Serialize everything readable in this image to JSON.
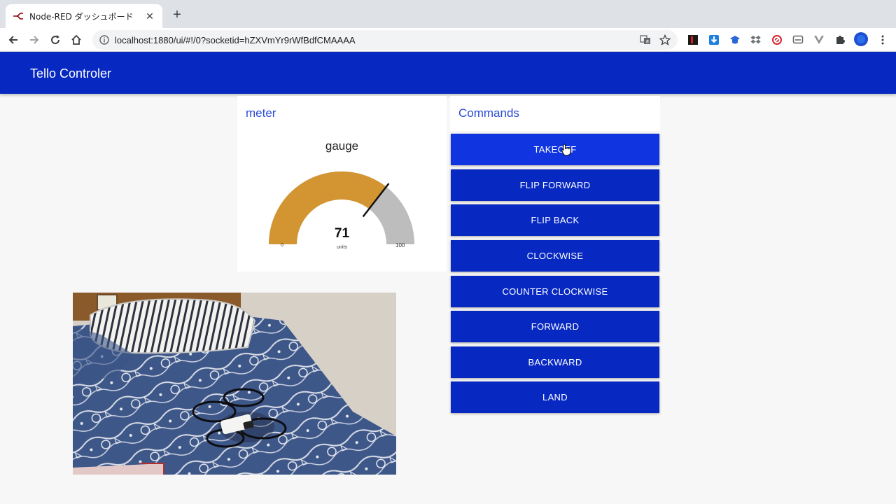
{
  "browser": {
    "tab_title": "Node-RED ダッシュボード",
    "url": "localhost:1880/ui/#!/0?socketid=hZXVmYr9rWfBdfCMAAAA"
  },
  "app": {
    "title": "Tello Controler"
  },
  "meter": {
    "card_title": "meter",
    "gauge_title": "gauge",
    "value": 71,
    "value_text": "71",
    "units": "units",
    "min": "0",
    "max": "100",
    "fill_color": "#d39531",
    "track_color": "#bdbdbd"
  },
  "commands": {
    "card_title": "Commands",
    "buttons": [
      "TAKEOFF",
      "FLIP FORWARD",
      "FLIP BACK",
      "CLOCKWISE",
      "COUNTER CLOCKWISE",
      "FORWARD",
      "BACKWARD",
      "LAND"
    ]
  },
  "colors": {
    "accent": "#0729c2",
    "title_text": "#2d4bd4"
  }
}
